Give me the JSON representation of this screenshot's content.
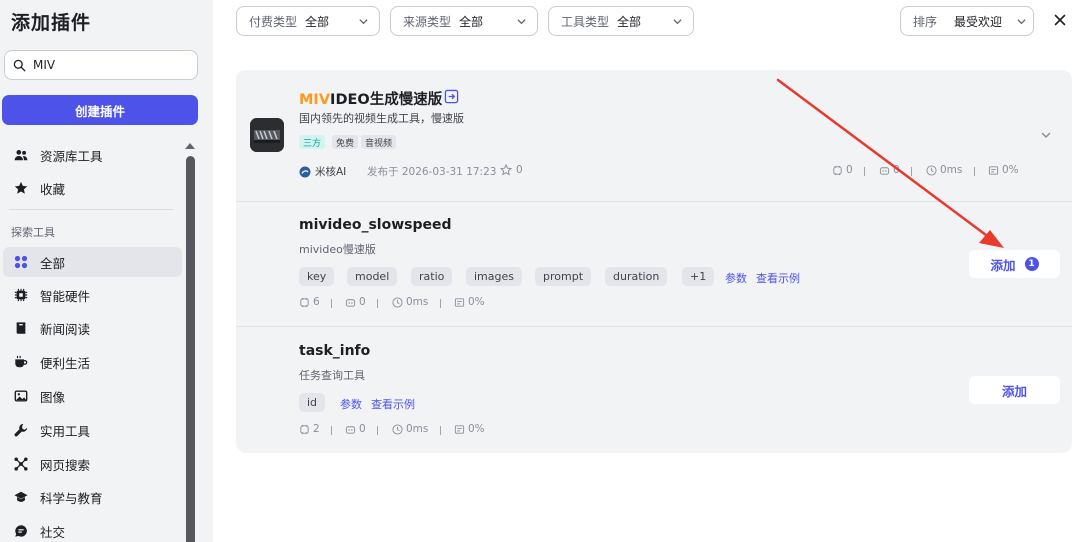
{
  "sidebar": {
    "title": "添加插件",
    "search_value": "MIV",
    "create_label": "创建插件",
    "top_items": [
      {
        "label": "资源库工具",
        "icon": "users-icon"
      },
      {
        "label": "收藏",
        "icon": "star-icon"
      }
    ],
    "section_label": "探索工具",
    "items": [
      {
        "label": "全部",
        "icon": "grid-icon",
        "active": true
      },
      {
        "label": "智能硬件",
        "icon": "chip-icon"
      },
      {
        "label": "新闻阅读",
        "icon": "book-icon"
      },
      {
        "label": "便利生活",
        "icon": "coffee-icon"
      },
      {
        "label": "图像",
        "icon": "image-icon"
      },
      {
        "label": "实用工具",
        "icon": "wrench-icon"
      },
      {
        "label": "网页搜索",
        "icon": "network-icon"
      },
      {
        "label": "科学与教育",
        "icon": "graduation-cap-icon"
      },
      {
        "label": "社交",
        "icon": "chat-icon"
      }
    ]
  },
  "filters": [
    {
      "label": "付费类型",
      "value": "全部"
    },
    {
      "label": "来源类型",
      "value": "全部"
    },
    {
      "label": "工具类型",
      "value": "全部"
    }
  ],
  "sort": {
    "label": "排序",
    "value": "最受欢迎"
  },
  "plugin": {
    "title_highlight": "MIV",
    "title_rest": "IDEO生成慢速版",
    "description": "国内领先的视频生成工具，慢速版",
    "tags": [
      "三方",
      "免费",
      "音视频"
    ],
    "author": "米核AI",
    "published": "发布于 2026-03-31 17:23",
    "favorites": "0",
    "stats": {
      "calls": "0",
      "bots": "0",
      "latency": "0ms",
      "success": "0%"
    }
  },
  "tools": [
    {
      "name": "mivideo_slowspeed",
      "description": "mivideo慢速版",
      "params": [
        "key",
        "model",
        "ratio",
        "images",
        "prompt",
        "duration",
        "+1"
      ],
      "params_link": "参数",
      "example_link": "查看示例",
      "add_label": "添加",
      "add_count": "1",
      "stats": {
        "calls": "6",
        "bots": "0",
        "latency": "0ms",
        "success": "0%"
      }
    },
    {
      "name": "task_info",
      "description": "任务查询工具",
      "params": [
        "id"
      ],
      "params_link": "参数",
      "example_link": "查看示例",
      "add_label": "添加",
      "stats": {
        "calls": "2",
        "bots": "0",
        "latency": "0ms",
        "success": "0%"
      }
    }
  ],
  "colors": {
    "accent": "#4d53e8",
    "highlight": "#ff9a1f",
    "annotation_arrow": "#e8392e"
  }
}
